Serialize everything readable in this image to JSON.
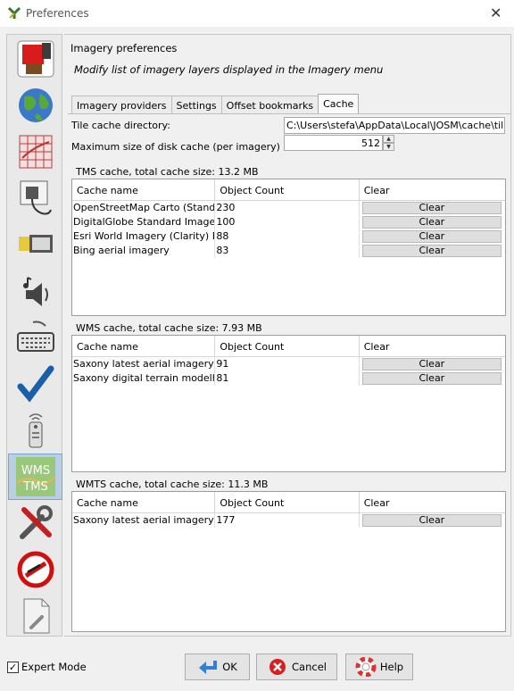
{
  "window": {
    "title": "Preferences",
    "app_icon": "josm-logo-icon",
    "close_glyph": "✕"
  },
  "sidebar": {
    "items": [
      {
        "icon": "display-settings-icon",
        "selected": false
      },
      {
        "icon": "globe-icon",
        "selected": false
      },
      {
        "icon": "map-grid-icon",
        "selected": false
      },
      {
        "icon": "plugin-plug-icon",
        "selected": false
      },
      {
        "icon": "folders-icon",
        "selected": false
      },
      {
        "icon": "audio-speaker-icon",
        "selected": false
      },
      {
        "icon": "keyboard-icon",
        "selected": false
      },
      {
        "icon": "validator-checkmark-icon",
        "selected": false
      },
      {
        "icon": "remote-control-icon",
        "selected": false
      },
      {
        "icon": "wms-tms-icon",
        "label_top": "WMS",
        "label_bottom": "TMS",
        "selected": true
      },
      {
        "icon": "tools-icon",
        "selected": false
      },
      {
        "icon": "no-entry-icon",
        "selected": false
      },
      {
        "icon": "advanced-document-icon",
        "selected": false
      }
    ]
  },
  "main": {
    "title": "Imagery preferences",
    "subtitle": "Modify list of imagery layers displayed in the Imagery menu",
    "tabs": [
      {
        "label": "Imagery providers",
        "active": false
      },
      {
        "label": "Settings",
        "active": false
      },
      {
        "label": "Offset bookmarks",
        "active": false
      },
      {
        "label": "Cache",
        "active": true
      }
    ],
    "tile_cache_label": "Tile cache directory:",
    "tile_cache_value": "C:\\Users\\stefa\\AppData\\Local\\JOSM\\cache\\tiles",
    "max_size_label": "Maximum size of disk cache (per imagery) in MB:",
    "max_size_value": "512",
    "columns": [
      "Cache name",
      "Object Count",
      "Clear"
    ],
    "clear_label": "Clear",
    "tms": {
      "title": "TMS cache, total cache size: 13.2 MB",
      "rows": [
        {
          "name": "OpenStreetMap Carto (Stand…",
          "count": "230"
        },
        {
          "name": "DigitalGlobe Standard Imagery",
          "count": "100"
        },
        {
          "name": "Esri World Imagery (Clarity) Beta",
          "count": "88"
        },
        {
          "name": "Bing aerial imagery",
          "count": "83"
        }
      ]
    },
    "wms": {
      "title": "WMS cache, total cache size: 7.93 MB",
      "rows": [
        {
          "name": "Saxony latest aerial imagery",
          "count": "91"
        },
        {
          "name": "Saxony digital terrain modelho…",
          "count": "81"
        }
      ]
    },
    "wmts": {
      "title": "WMTS cache, total cache size: 11.3 MB",
      "rows": [
        {
          "name": "Saxony latest aerial imagery …",
          "count": "177"
        }
      ]
    }
  },
  "footer": {
    "expert_mode_label": "Expert Mode",
    "expert_mode_checked": true,
    "ok_label": "OK",
    "cancel_label": "Cancel",
    "help_label": "Help",
    "colors": {
      "ok_icon": "#2f7fd6",
      "cancel_icon": "#d62020",
      "help_icon": "#e03030",
      "selection": "#b8cfe5"
    }
  }
}
